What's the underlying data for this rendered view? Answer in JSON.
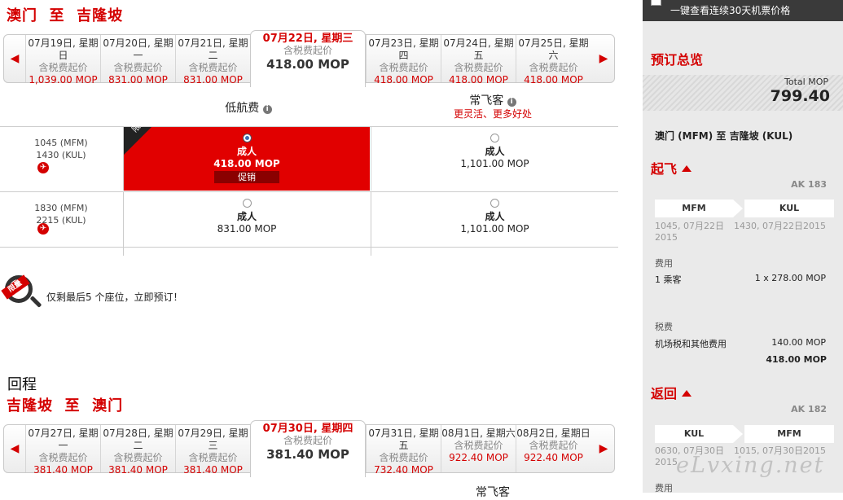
{
  "outbound": {
    "title_from": "澳门",
    "title_sep": "至",
    "title_to": "吉隆坡",
    "dates": [
      {
        "date": "07月19日, 星期",
        "weekday": "日",
        "sub": "含税费起价",
        "price": "1,039.00 MOP"
      },
      {
        "date": "07月20日, 星期",
        "weekday": "一",
        "sub": "含税费起价",
        "price": "831.00 MOP"
      },
      {
        "date": "07月21日, 星期",
        "weekday": "二",
        "sub": "含税费起价",
        "price": "831.00 MOP"
      },
      {
        "date": "07月22日, 星期三",
        "weekday": "",
        "sub": "含税费起价",
        "price": "418.00 MOP",
        "active": true
      },
      {
        "date": "07月23日, 星期",
        "weekday": "四",
        "sub": "含税费起价",
        "price": "418.00 MOP"
      },
      {
        "date": "07月24日, 星期",
        "weekday": "五",
        "sub": "含税费起价",
        "price": "418.00 MOP"
      },
      {
        "date": "07月25日, 星期",
        "weekday": "六",
        "sub": "含税费起价",
        "price": "418.00 MOP"
      }
    ],
    "col_low": "低航费",
    "col_freq": "常飞客",
    "col_freq_sub": "更灵活、更多好处",
    "flights": [
      {
        "dep": "1045 (MFM)",
        "arr": "1430 (KUL)",
        "low_type": "成人",
        "low_price": "418.00 MOP",
        "promo": "促销",
        "corner": "限量",
        "freq_type": "成人",
        "freq_price": "1,101.00 MOP"
      },
      {
        "dep": "1830 (MFM)",
        "arr": "2215 (KUL)",
        "low_type": "成人",
        "low_price": "831.00 MOP",
        "freq_type": "成人",
        "freq_price": "1,101.00 MOP"
      }
    ],
    "badge_label": "限量",
    "limited_msg": "仅剩最后5 个座位，立即预订！"
  },
  "return": {
    "section": "回程",
    "title_from": "吉隆坡",
    "title_sep": "至",
    "title_to": "澳门",
    "dates": [
      {
        "date": "07月27日, 星期",
        "weekday": "一",
        "sub": "含税费起价",
        "price": "381.40 MOP"
      },
      {
        "date": "07月28日, 星期",
        "weekday": "二",
        "sub": "含税费起价",
        "price": "381.40 MOP"
      },
      {
        "date": "07月29日, 星期",
        "weekday": "三",
        "sub": "含税费起价",
        "price": "381.40 MOP"
      },
      {
        "date": "07月30日, 星期四",
        "weekday": "",
        "sub": "含税费起价",
        "price": "381.40 MOP",
        "active": true
      },
      {
        "date": "07月31日, 星期",
        "weekday": "五",
        "sub": "含税费起价",
        "price": "732.40 MOP"
      },
      {
        "date": "08月1日, 星期六",
        "weekday": "",
        "sub": "含税费起价",
        "price": "922.40 MOP"
      },
      {
        "date": "08月2日, 星期日",
        "weekday": "",
        "sub": "含税费起价",
        "price": "922.40 MOP"
      }
    ],
    "col_freq": "常飞客"
  },
  "sidebar": {
    "topbar": "一键查看连续30天机票价格",
    "summary_title": "预订总览",
    "total_label": "Total MOP",
    "total_value": "799.40",
    "route": "澳门 (MFM) 至 吉隆坡 (KUL)",
    "depart": {
      "title": "起飞",
      "flight_no": "AK 183",
      "from": "MFM",
      "to": "KUL",
      "from_time": "1045, 07月22日 2015",
      "to_time": "1430, 07月22日2015",
      "fare_label": "费用",
      "pax": "1 乘客",
      "pax_price": "1 x 278.00 MOP",
      "tax_label": "税费",
      "tax_item": "机场税和其他费用",
      "tax_price": "140.00 MOP",
      "subtotal": "418.00 MOP"
    },
    "ret": {
      "title": "返回",
      "flight_no": "AK 182",
      "from": "KUL",
      "to": "MFM",
      "from_time": "0630, 07月30日 2015",
      "to_time": "1015, 07月30日2015",
      "fare_label": "费用"
    }
  },
  "watermark": "eLvxing.net"
}
